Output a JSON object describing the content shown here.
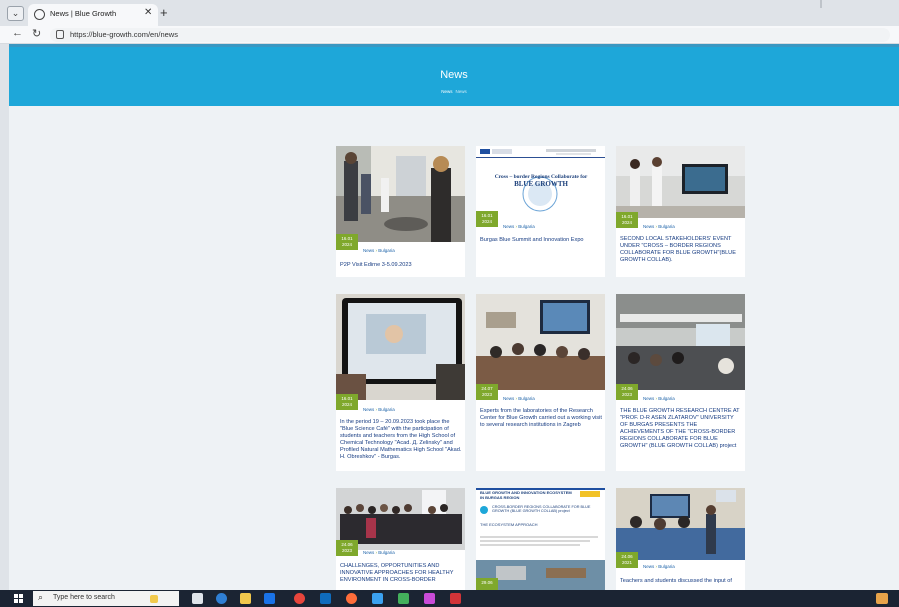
{
  "browser": {
    "tab_title": "News | Blue Growth",
    "url": "https://blue-growth.com/en/news",
    "new_tab_glyph": "+",
    "close_glyph": "✕"
  },
  "hero": {
    "title": "News",
    "breadcrumb_home": "News",
    "breadcrumb_current": "News"
  },
  "cards": [
    {
      "date_day": "16.01",
      "date_year": "2024",
      "category": "News",
      "subcategory": "Bulgaria",
      "title": "P2P Visit Edirne 3-5.09.2023"
    },
    {
      "date_day": "16.01",
      "date_year": "2024",
      "category": "News",
      "subcategory": "Bulgaria",
      "title": "Burgas Blue Summit and Innovation Expo"
    },
    {
      "date_day": "16.01",
      "date_year": "2024",
      "category": "News",
      "subcategory": "Bulgaria",
      "title": "SECOND LOCAL STAKEHOLDERS' EVENT UNDER \"CROSS – BORDER REGIONS COLLABORATE FOR BLUE GROWTH\"(BLUE GROWTH COLLAB)."
    },
    {
      "date_day": "16.01",
      "date_year": "2024",
      "category": "News",
      "subcategory": "Bulgaria",
      "title": "In the period 19 – 20.09.2023 took place the \"Blue Science Café\" with the participation of students and teachers from the High School of Chemical Technology \"Acad. Д. Zelinsky\" and Profiled Natural Mathematics High School \"Akad. H. Obreshkov\" - Burgas."
    },
    {
      "date_day": "24.07",
      "date_year": "2023",
      "category": "News",
      "subcategory": "Bulgaria",
      "title": "Experts from the laboratories of the Research Center for Blue Growth carried out a working visit to several research institutions in Zagreb"
    },
    {
      "date_day": "24.06",
      "date_year": "2023",
      "category": "News",
      "subcategory": "Bulgaria",
      "title": "THE BLUE GROWTH RESEARCH CENTRE AT \"PROF. D-R ASEN ZLATAROV\" UNIVERSITY OF BURGAS PRESENTS THE ACHIEVEMENTS OF THE \"CROSS-BORDER REGIONS COLLABORATE FOR BLUE GROWTH\" (BLUE GROWTH COLLAB) project"
    },
    {
      "date_day": "24.06",
      "date_year": "2023",
      "category": "News",
      "subcategory": "Bulgaria",
      "title": "CHALLENGES, OPPORTUNITIES AND INNOVATIVE APPROACHES FOR HEALTHY ENVIRONMENT IN CROSS-BORDER"
    },
    {
      "date_day": "29.06",
      "date_year": "",
      "category": "",
      "subcategory": "",
      "title": ""
    },
    {
      "date_day": "24.06",
      "date_year": "2021",
      "category": "News",
      "subcategory": "Bulgaria",
      "title": "Teachers and students discussed the input of"
    }
  ],
  "poster_2": {
    "heading": "Cross – border Regions Collaborate for",
    "heading_big": "BLUE GROWTH"
  },
  "poster_8": {
    "heading": "BLUE GROWTH AND INNOVATION ECOSYSTEM IN BURGAS REGION",
    "subheading": "CROSS-BORDER REGIONS COLLABORATE FOR BLUE GROWTH (BLUE GROWTH COLLAB) project",
    "section": "THE ECOSYSTEM APPROACH"
  },
  "taskbar": {
    "search_placeholder": "Type here to search"
  },
  "colors": {
    "hero": "#1ea7d9",
    "badge": "#7fa82c",
    "title_link": "#173c82"
  }
}
